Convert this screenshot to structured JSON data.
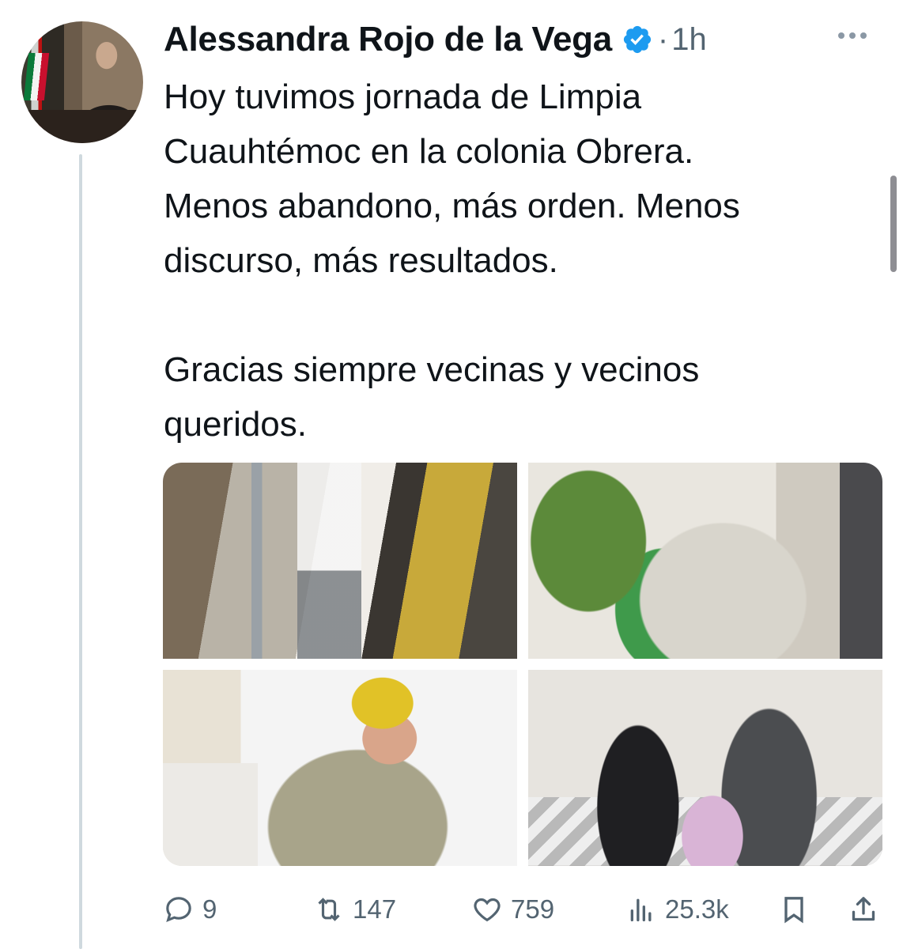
{
  "author": {
    "name": "Alessandra Rojo de la Vega",
    "verified_icon": "verified-badge-icon",
    "dot": "·",
    "time": "1h"
  },
  "tweet": {
    "text": "Hoy tuvimos jornada de Limpia\nCuauhtémoc en la colonia Obrera.\nMenos abandono, más orden. Menos\ndiscurso, más resultados.\n\nGracias siempre vecinas y vecinos\nqueridos."
  },
  "actions": {
    "replies": "9",
    "reposts": "147",
    "likes": "759",
    "views": "25.3k"
  },
  "colors": {
    "verified": "#1d9bf0",
    "secondary_text": "#536471"
  }
}
